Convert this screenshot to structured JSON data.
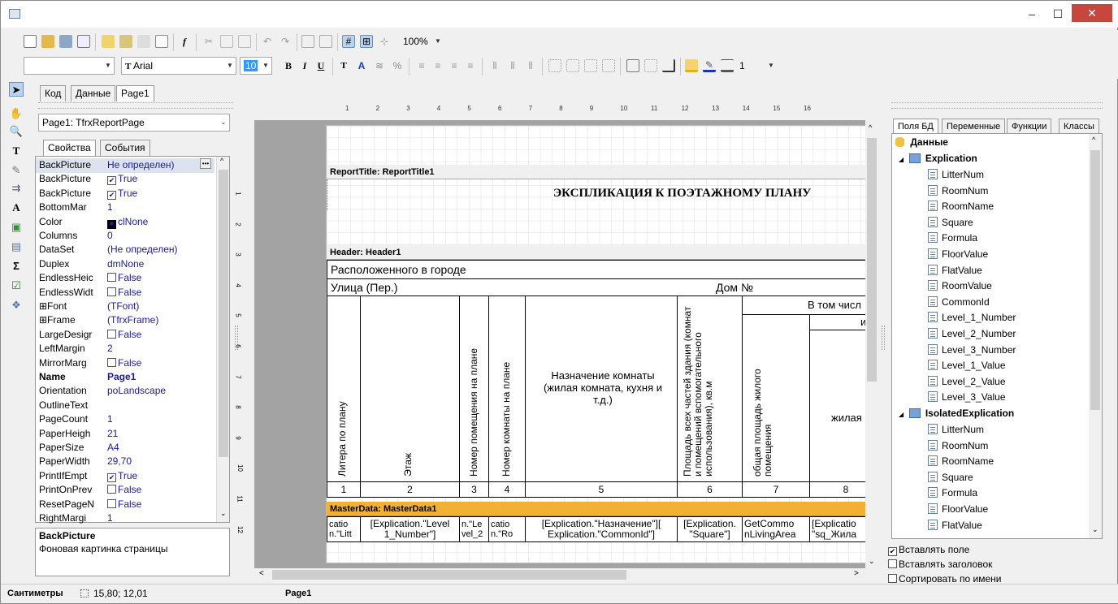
{
  "window": {
    "minimize": "–",
    "maximize": "☐",
    "close": "✕"
  },
  "toolbar2": {
    "zoom": "100%"
  },
  "toolbar3": {
    "style_value": "",
    "font": "Arial",
    "font_size": "10",
    "bold": "B",
    "italic": "I",
    "underline": "U",
    "frame_width": "1"
  },
  "doc_tabs": [
    "Код",
    "Данные",
    "Page1"
  ],
  "inspector": {
    "object_selector": "Page1: TfrxReportPage",
    "tabs": [
      "Свойства",
      "События"
    ],
    "props": [
      {
        "name": "BackPicture",
        "value": "Не определен)",
        "bold": false,
        "cb": ""
      },
      {
        "name": "BackPicture",
        "value": "True",
        "bold": false,
        "cb": "✔"
      },
      {
        "name": "BackPicture",
        "value": "True",
        "bold": false,
        "cb": "✔"
      },
      {
        "name": "BottomMar",
        "value": "1",
        "bold": false,
        "cb": ""
      },
      {
        "name": "Color",
        "value": "clNone",
        "bold": false,
        "cb": "■"
      },
      {
        "name": "Columns",
        "value": "0",
        "bold": false,
        "cb": ""
      },
      {
        "name": "DataSet",
        "value": "(Не определен)",
        "bold": false,
        "cb": ""
      },
      {
        "name": "Duplex",
        "value": "dmNone",
        "bold": false,
        "cb": ""
      },
      {
        "name": "EndlessHeic",
        "value": "False",
        "bold": false,
        "cb": "☐"
      },
      {
        "name": "EndlessWidt",
        "value": "False",
        "bold": false,
        "cb": "☐"
      },
      {
        "name": "⊞Font",
        "value": "(TFont)",
        "bold": false,
        "cb": ""
      },
      {
        "name": "⊞Frame",
        "value": "(TfrxFrame)",
        "bold": false,
        "cb": ""
      },
      {
        "name": "LargeDesigr",
        "value": "False",
        "bold": false,
        "cb": "☐"
      },
      {
        "name": "LeftMargin",
        "value": "2",
        "bold": false,
        "cb": ""
      },
      {
        "name": "MirrorMarg",
        "value": "False",
        "bold": false,
        "cb": "☐"
      },
      {
        "name": "Name",
        "value": "Page1",
        "bold": true,
        "cb": ""
      },
      {
        "name": "Orientation",
        "value": "poLandscape",
        "bold": false,
        "cb": ""
      },
      {
        "name": "OutlineText",
        "value": "",
        "bold": false,
        "cb": ""
      },
      {
        "name": "PageCount",
        "value": "1",
        "bold": false,
        "cb": ""
      },
      {
        "name": "PaperHeigh",
        "value": "21",
        "bold": false,
        "cb": ""
      },
      {
        "name": "PaperSize",
        "value": "A4",
        "bold": false,
        "cb": ""
      },
      {
        "name": "PaperWidth",
        "value": "29,70",
        "bold": false,
        "cb": ""
      },
      {
        "name": "PrintIfEmpt",
        "value": "True",
        "bold": false,
        "cb": "✔"
      },
      {
        "name": "PrintOnPrev",
        "value": "False",
        "bold": false,
        "cb": "☐"
      },
      {
        "name": "ResetPageN",
        "value": "False",
        "bold": false,
        "cb": "☐"
      },
      {
        "name": "RightMargi",
        "value": "1",
        "bold": false,
        "cb": ""
      }
    ],
    "desc_title": "BackPicture",
    "desc_text": "Фоновая картинка страницы"
  },
  "ruler": {
    "marks": [
      "1",
      "2",
      "3",
      "4",
      "5",
      "6",
      "7",
      "8",
      "9",
      "10",
      "11",
      "12",
      "13",
      "14",
      "15",
      "16"
    ]
  },
  "vruler": {
    "marks": [
      "1",
      "2",
      "3",
      "4",
      "5",
      "6",
      "7",
      "8",
      "9",
      "10",
      "11",
      "12"
    ]
  },
  "report": {
    "title_band": "ReportTitle: ReportTitle1",
    "title_text": "ЭКСПЛИКАЦИЯ К ПОЭТАЖНОМУ ПЛАНУ",
    "header_band": "Header: Header1",
    "row_city": "Расположенного в городе",
    "row_street": "Улица (Пер.)",
    "row_house": "Дом №",
    "incl": "В том числ",
    "incl_i": "и",
    "col1": "Литера по плану",
    "col2": "Этаж",
    "col3": "Номер помещения на плане",
    "col4": "Номер комнаты на плане",
    "col5": "Назначение комнаты (жилая комната, кухня и т.д.)",
    "col6": "Площадь всех частей здания (комнат и помещений вспомогательного использования), кв.м",
    "col7": "общая площадь жилого помещения",
    "col8": "жилая",
    "nums": [
      "1",
      "2",
      "3",
      "4",
      "5",
      "6",
      "7",
      "8"
    ],
    "master_band": "MasterData: MasterData1",
    "m1": "catio n.\"Litt",
    "m2": "[Explication.\"Level 1_Number\"]",
    "m3": "n.\"Le vel_2",
    "m4": "catio n.\"Ro",
    "m5": "[Explication.\"Назначение\"][ Explication.\"CommonId\"]",
    "m6": "[Explication. \"Square\"]",
    "m7": "GetCommo nLivingArea",
    "m8": "[Explicatio \"sq_Жила"
  },
  "right_panel": {
    "tabs": [
      "Поля БД",
      "Переменные",
      "Функции",
      "Классы"
    ],
    "root": "Данные",
    "ds1": "Explication",
    "fields1": [
      "LitterNum",
      "RoomNum",
      "RoomName",
      "Square",
      "Formula",
      "FloorValue",
      "FlatValue",
      "RoomValue",
      "CommonId",
      "Level_1_Number",
      "Level_2_Number",
      "Level_3_Number",
      "Level_1_Value",
      "Level_2_Value",
      "Level_3_Value"
    ],
    "ds2": "IsolatedExplication",
    "fields2": [
      "LitterNum",
      "RoomNum",
      "RoomName",
      "Square",
      "Formula",
      "FloorValue",
      "FlatValue"
    ],
    "opt1": "Вставлять поле",
    "opt2": "Вставлять заголовок",
    "opt3": "Сортировать по имени"
  },
  "status": {
    "units": "Сантиметры",
    "coords": "15,80; 12,01",
    "page": "Page1"
  }
}
